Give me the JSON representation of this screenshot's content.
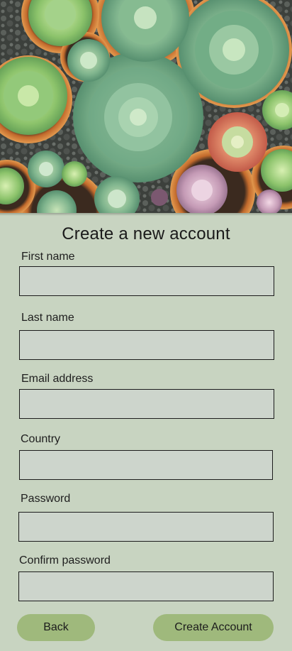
{
  "hero": {
    "image": "succulents-in-pots-photo"
  },
  "form": {
    "title": "Create a new account",
    "fields": [
      {
        "label": "First name",
        "value": "",
        "placeholder": ""
      },
      {
        "label": "Last name",
        "value": "",
        "placeholder": ""
      },
      {
        "label": "Email address",
        "value": "",
        "placeholder": ""
      },
      {
        "label": "Country",
        "value": "",
        "placeholder": ""
      },
      {
        "label": "Password",
        "value": "",
        "placeholder": ""
      },
      {
        "label": "Confirm password",
        "value": "",
        "placeholder": ""
      }
    ]
  },
  "actions": {
    "back_label": "Back",
    "create_label": "Create Account"
  },
  "colors": {
    "background": "#c8d4c1",
    "field_fill": "#cdd5cc",
    "button": "#9fb97c"
  }
}
